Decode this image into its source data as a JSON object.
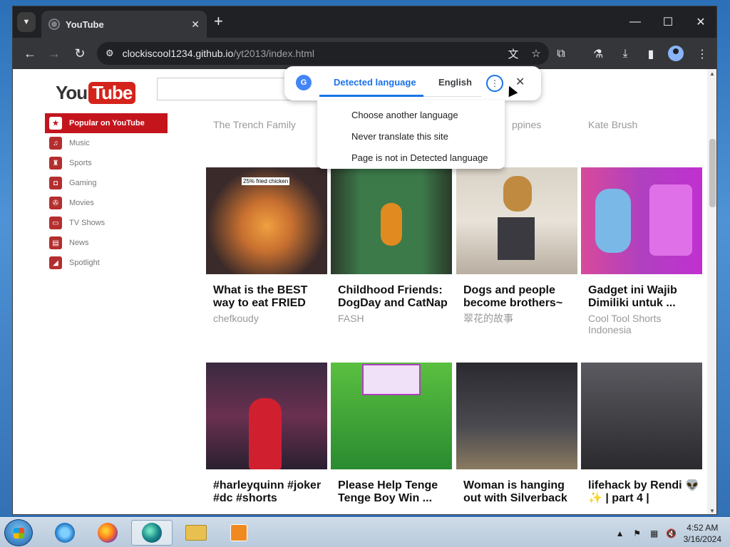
{
  "browser": {
    "tab_title": "YouTube",
    "tab_close": "✕",
    "new_tab": "+",
    "url_host": "clockiscool1234.github.io",
    "url_path": "/yt2013/index.html",
    "window_controls": [
      "—",
      "☐",
      "✕"
    ]
  },
  "youtube": {
    "logo_you": "You",
    "logo_tube": "Tube",
    "sidebar": [
      {
        "label": "Popular on YouTube",
        "icon": "star-icon",
        "active": true
      },
      {
        "label": "Music",
        "icon": "headphones-icon",
        "active": false
      },
      {
        "label": "Sports",
        "icon": "trophy-icon",
        "active": false
      },
      {
        "label": "Gaming",
        "icon": "gamepad-icon",
        "active": false
      },
      {
        "label": "Movies",
        "icon": "film-reel-icon",
        "active": false
      },
      {
        "label": "TV Shows",
        "icon": "tv-icon",
        "active": false
      },
      {
        "label": "News",
        "icon": "newspaper-icon",
        "active": false
      },
      {
        "label": "Spotlight",
        "icon": "spotlight-icon",
        "active": false
      }
    ],
    "top_row_channels": [
      "The Trench Family",
      "ppines",
      "Kate Brush"
    ],
    "videos_row1": [
      {
        "title": "What is the BEST way to eat FRIED CHICKEN? Wit...",
        "channel": "chefkoudy",
        "thumb_label": "25% fried chicken"
      },
      {
        "title": "Childhood Friends: DogDay and CatNap (Poppy...",
        "channel": "FASH"
      },
      {
        "title": "Dogs and people become brothers~ #funny #cute #fun...",
        "channel": "翠花的故事"
      },
      {
        "title": "Gadget ini Wajib Dimiliki untuk ...",
        "channel": "Cool Tool Shorts Indonesia"
      }
    ],
    "videos_row2": [
      {
        "title": "#harleyquinn #joker #dc #shorts",
        "channel": ""
      },
      {
        "title": "Please Help Tenge Tenge Boy Win ...",
        "channel": ""
      },
      {
        "title": "Woman is hanging out with Silverback Gorilla ...",
        "channel": ""
      },
      {
        "title": "lifehack by Rendi 👽✨ | part 4 |",
        "channel": ""
      }
    ]
  },
  "translate": {
    "tab_detected": "Detected language",
    "tab_english": "English",
    "menu": [
      "Choose another language",
      "Never translate this site",
      "Page is not in Detected language"
    ]
  },
  "taskbar": {
    "time": "4:52 AM",
    "date": "3/16/2024"
  }
}
